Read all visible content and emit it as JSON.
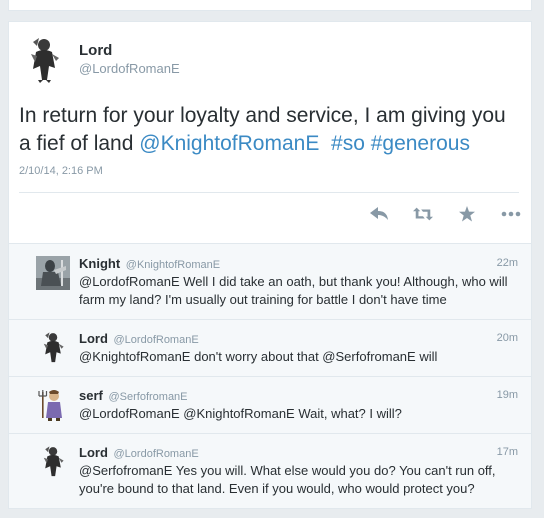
{
  "tweet": {
    "display_name": "Lord",
    "handle": "@LordofRomanE",
    "text_before": "In return for your loyalty and service, I am giving you a fief of land ",
    "mention": "@KnightofRomanE",
    "hashtag1": "#so",
    "hashtag2": "#generous",
    "timestamp": "2/10/14, 2:16 PM",
    "actions": [
      "reply-icon",
      "retweet-icon",
      "favorite-icon",
      "more-icon"
    ]
  },
  "replies": [
    {
      "name": "Knight",
      "handle": "@KnightofRomanE",
      "time": "22m",
      "text": "@LordofRomanE Well I did take an oath, but thank you! Although, who will farm my land? I'm usually out training for battle I don't have time"
    },
    {
      "name": "Lord",
      "handle": "@LordofRomanE",
      "time": "20m",
      "text": "@KnightofRomanE don't worry about that @SerfofromanE will"
    },
    {
      "name": "serf",
      "handle": "@SerfofromanE",
      "time": "19m",
      "text": "@LordofRomanE @KnightofRomanE Wait, what? I will?"
    },
    {
      "name": "Lord",
      "handle": "@LordofRomanE",
      "time": "17m",
      "text": "@SerfofromanE Yes you will. What else would you do? You can't run off, you're bound to that land. Even if you would, who would protect you?"
    }
  ],
  "colors": {
    "link": "#3b8ac4",
    "muted": "#8899a6",
    "text": "#292f33"
  }
}
